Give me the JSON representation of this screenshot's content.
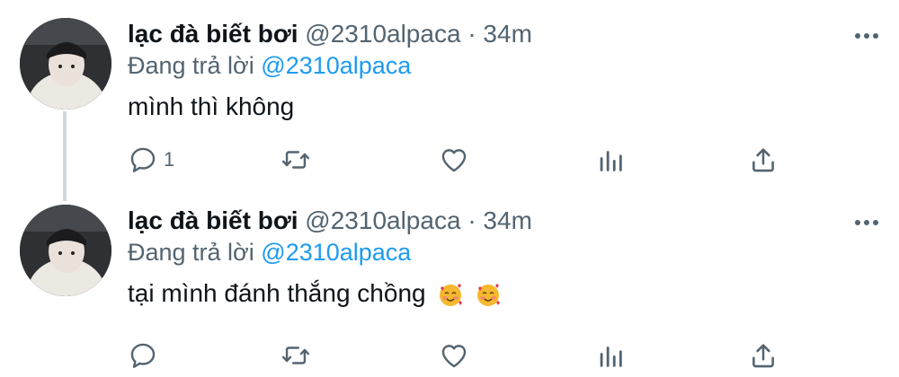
{
  "tweets": [
    {
      "author_name": "lạc đà biết bơi",
      "handle": "@2310alpaca",
      "separator": "·",
      "time": "34m",
      "reply_prefix": "Đang trả lời",
      "reply_to": "@2310alpaca",
      "text": "mình thì không",
      "reply_count": "1",
      "emoji": []
    },
    {
      "author_name": "lạc đà biết bơi",
      "handle": "@2310alpaca",
      "separator": "·",
      "time": "34m",
      "reply_prefix": "Đang trả lời",
      "reply_to": "@2310alpaca",
      "text": "tại mình đánh thắng chồng",
      "reply_count": "",
      "emoji": [
        "smiling-face-with-hearts",
        "smiling-face-with-hearts"
      ]
    }
  ],
  "icons": [
    "more-icon",
    "reply-icon",
    "retweet-icon",
    "like-icon",
    "analytics-icon",
    "share-icon"
  ],
  "colors": {
    "link": "#1d9bf0",
    "secondary_text": "#536471",
    "primary_text": "#0f1419",
    "thread_line": "#cfd9de"
  }
}
